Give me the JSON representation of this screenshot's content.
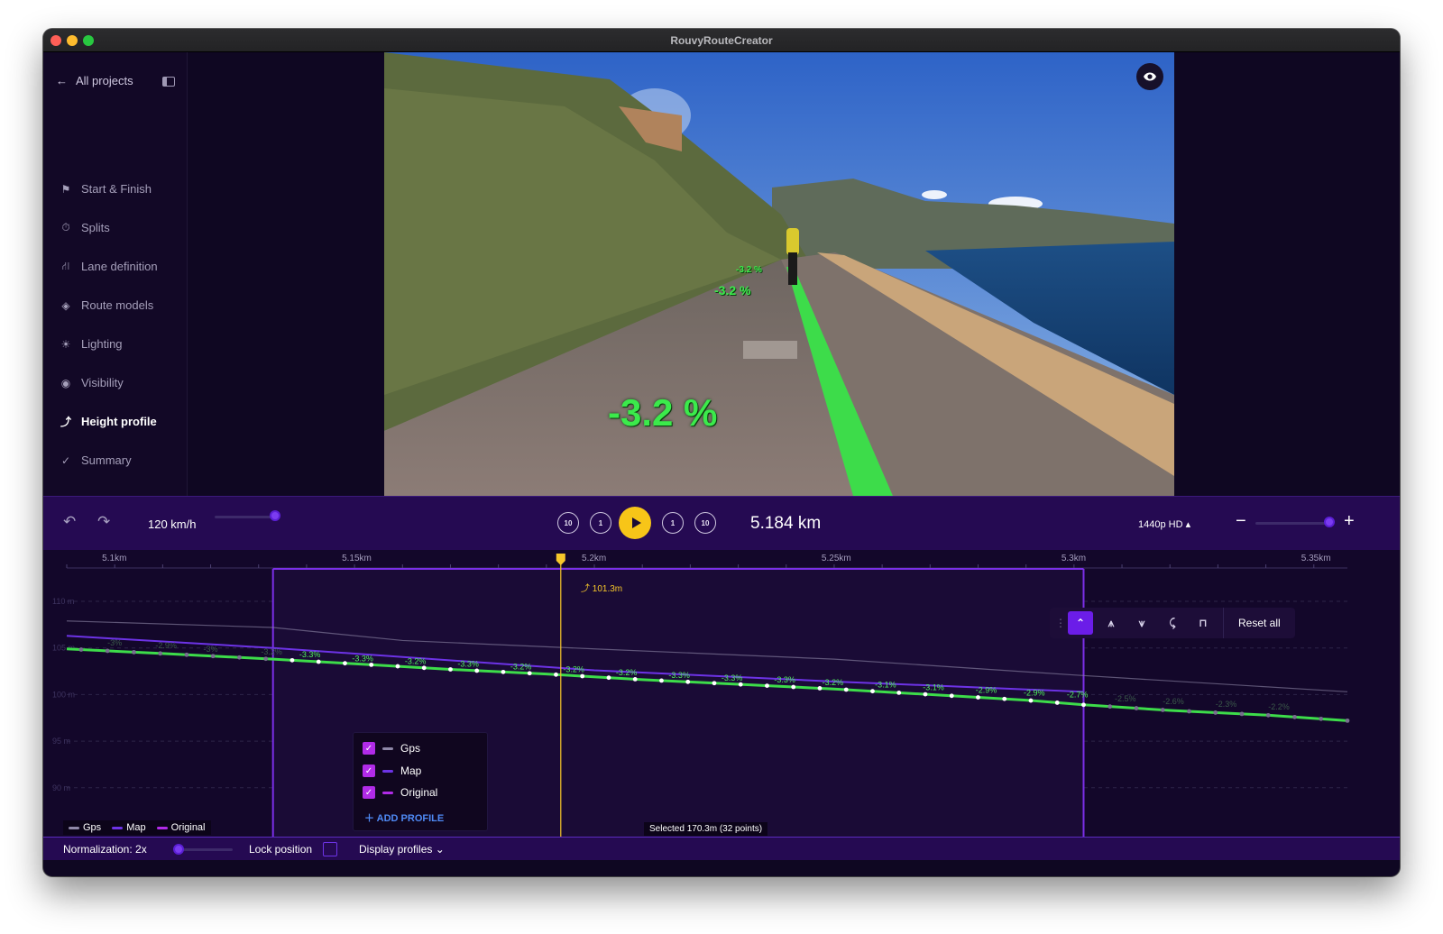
{
  "window": {
    "title": "RouvyRouteCreator"
  },
  "sidebar": {
    "back_label": "All projects",
    "items": [
      {
        "label": "Start & Finish",
        "icon": "flag-icon",
        "active": false
      },
      {
        "label": "Splits",
        "icon": "stopwatch-icon",
        "active": false
      },
      {
        "label": "Lane definition",
        "icon": "road-icon",
        "active": false
      },
      {
        "label": "Route models",
        "icon": "cube-icon",
        "active": false
      },
      {
        "label": "Lighting",
        "icon": "sun-icon",
        "active": false
      },
      {
        "label": "Visibility",
        "icon": "eye-icon",
        "active": false
      },
      {
        "label": "Height profile",
        "icon": "height-profile-icon",
        "active": true
      },
      {
        "label": "Summary",
        "icon": "checkmark-icon",
        "active": false
      }
    ]
  },
  "video": {
    "grade_large": "-3.2 %",
    "grade_mid": "-3.2 %",
    "grade_small": "-3.2 %"
  },
  "playback": {
    "speed": "120 km/h",
    "speed_slider_fraction": 0.95,
    "back10_label": "10",
    "back1_label": "1",
    "fwd1_label": "1",
    "fwd10_label": "10",
    "distance": "5.184 km",
    "quality": "1440p HD",
    "zoom_slider_fraction": 1.0
  },
  "chart_data": {
    "type": "line",
    "x_unit": "km",
    "x_ticks": [
      "5.1km",
      "5.15km",
      "5.2km",
      "5.25km",
      "5.3km",
      "5.35km"
    ],
    "x_tick_values": [
      5.1,
      5.15,
      5.2,
      5.25,
      5.3,
      5.35
    ],
    "xlim": [
      5.09,
      5.357
    ],
    "y_ticks": [
      "110 m",
      "105 m",
      "100 m",
      "95 m",
      "90 m"
    ],
    "y_tick_values": [
      110,
      105,
      100,
      95,
      90
    ],
    "ylim": [
      86.5,
      113
    ],
    "grid": true,
    "cursor": {
      "x": 5.193,
      "label": "101.3m"
    },
    "selection": {
      "x_start": 5.133,
      "x_end": 5.302,
      "note": "Selected 170.3m (32 points)"
    },
    "series": [
      {
        "name": "Gps",
        "color": "#8f88a8",
        "x": [
          5.09,
          5.133,
          5.16,
          5.2,
          5.25,
          5.3,
          5.357
        ],
        "y": [
          107.9,
          107.2,
          105.8,
          104.9,
          103.8,
          102.1,
          100.3
        ]
      },
      {
        "name": "Map",
        "color": "#6d33e6",
        "x": [
          5.09,
          5.133,
          5.2,
          5.25,
          5.302
        ],
        "y": [
          106.3,
          105.0,
          102.6,
          101.4,
          100.3
        ]
      },
      {
        "name": "Original",
        "color": "#3ddc4a",
        "x": [
          5.09,
          5.11,
          5.133,
          5.15,
          5.17,
          5.19,
          5.21,
          5.23,
          5.25,
          5.27,
          5.29,
          5.302,
          5.32,
          5.34,
          5.357
        ],
        "y": [
          104.9,
          104.4,
          103.8,
          103.3,
          102.7,
          102.2,
          101.6,
          101.1,
          100.6,
          100.0,
          99.4,
          98.9,
          98.3,
          97.8,
          97.2
        ]
      }
    ],
    "grade_labels": [
      {
        "x": 5.1,
        "y": 104.9,
        "text": "-3%"
      },
      {
        "x": 5.11,
        "y": 104.6,
        "text": "-2.9%"
      },
      {
        "x": 5.12,
        "y": 104.2,
        "text": "-3%"
      },
      {
        "x": 5.132,
        "y": 103.9,
        "text": "-3.2%"
      },
      {
        "x": 5.14,
        "y": 103.6,
        "text": "-3.3%"
      },
      {
        "x": 5.151,
        "y": 103.2,
        "text": "-3.3%"
      },
      {
        "x": 5.162,
        "y": 102.9,
        "text": "-3.2%"
      },
      {
        "x": 5.173,
        "y": 102.6,
        "text": "-3.3%"
      },
      {
        "x": 5.184,
        "y": 102.3,
        "text": "-3.2%"
      },
      {
        "x": 5.195,
        "y": 102.0,
        "text": "-3.2%"
      },
      {
        "x": 5.206,
        "y": 101.7,
        "text": "-3.2%"
      },
      {
        "x": 5.217,
        "y": 101.4,
        "text": "-3.3%"
      },
      {
        "x": 5.228,
        "y": 101.1,
        "text": "-3.3%"
      },
      {
        "x": 5.239,
        "y": 100.9,
        "text": "-3.3%"
      },
      {
        "x": 5.249,
        "y": 100.6,
        "text": "-3.2%"
      },
      {
        "x": 5.26,
        "y": 100.4,
        "text": "-3.1%"
      },
      {
        "x": 5.27,
        "y": 100.1,
        "text": "-3.1%"
      },
      {
        "x": 5.281,
        "y": 99.8,
        "text": "-2.9%"
      },
      {
        "x": 5.291,
        "y": 99.5,
        "text": "-2.9%"
      },
      {
        "x": 5.3,
        "y": 99.3,
        "text": "-2.7%"
      },
      {
        "x": 5.31,
        "y": 98.9,
        "text": "-2.5%"
      },
      {
        "x": 5.32,
        "y": 98.6,
        "text": "-2.6%"
      },
      {
        "x": 5.331,
        "y": 98.3,
        "text": "-2.3%"
      },
      {
        "x": 5.342,
        "y": 98.0,
        "text": "-2.2%"
      }
    ]
  },
  "profile_toolbar": {
    "reset_label": "Reset all"
  },
  "profiles_popup": {
    "items": [
      {
        "label": "Gps",
        "checked": true,
        "color": "#8f88a8"
      },
      {
        "label": "Map",
        "checked": true,
        "color": "#6d33e6"
      },
      {
        "label": "Original",
        "checked": true,
        "color": "#b12be8"
      }
    ],
    "add_label": "ADD PROFILE"
  },
  "mini_legend": [
    {
      "label": "Gps",
      "color": "#8f88a8"
    },
    {
      "label": "Map",
      "color": "#6d33e6"
    },
    {
      "label": "Original",
      "color": "#b12be8"
    }
  ],
  "bottom_bar": {
    "normalization": "Normalization: 2x",
    "normalization_fraction": 0.0,
    "lock_label": "Lock position",
    "display_profiles": "Display profiles"
  }
}
